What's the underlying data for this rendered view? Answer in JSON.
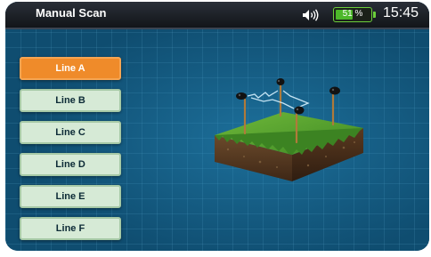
{
  "header": {
    "title": "Manual Scan",
    "volume_icon": "speaker-volume-icon",
    "battery": {
      "level_percent": 51,
      "text": "51",
      "unit": "%"
    },
    "time": "15:45"
  },
  "lines": [
    {
      "label": "Line A",
      "selected": true
    },
    {
      "label": "Line B",
      "selected": false
    },
    {
      "label": "Line C",
      "selected": false
    },
    {
      "label": "Line D",
      "selected": false
    },
    {
      "label": "Line E",
      "selected": false
    },
    {
      "label": "Line F",
      "selected": false
    }
  ],
  "colors": {
    "selected_button": "#ef8b2a",
    "button": "#d6ead6",
    "background": "#0f4d70",
    "battery": "#4db82a"
  }
}
